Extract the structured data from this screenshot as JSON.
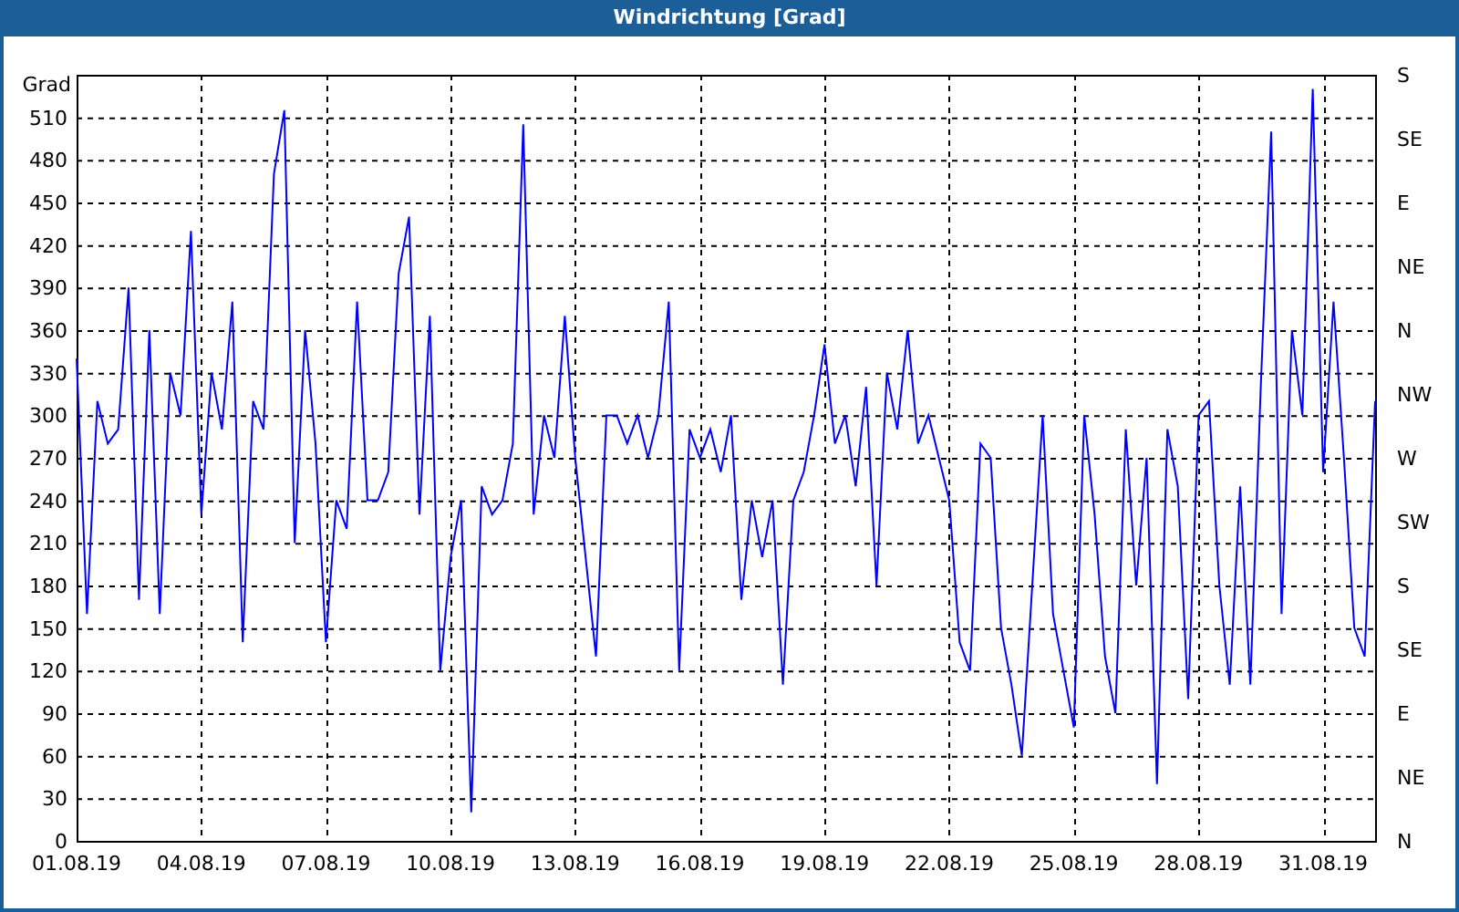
{
  "window": {
    "title": "Windrichtung [Grad]"
  },
  "chart": {
    "chart_data": {
      "type": "line",
      "grid": true,
      "ylabel": "Grad",
      "ylim": [
        0,
        540
      ],
      "yticks": [
        0,
        30,
        60,
        90,
        120,
        150,
        180,
        210,
        240,
        270,
        300,
        330,
        360,
        390,
        420,
        450,
        480,
        510
      ],
      "categories": [
        "01.08.19",
        null,
        null,
        null,
        null,
        null,
        null,
        null,
        null,
        null,
        null,
        null,
        "04.08.19",
        null,
        null,
        null,
        null,
        null,
        null,
        null,
        null,
        null,
        null,
        null,
        "07.08.19",
        null,
        null,
        null,
        null,
        null,
        null,
        null,
        null,
        null,
        null,
        null,
        "10.08.19",
        null,
        null,
        null,
        null,
        null,
        null,
        null,
        null,
        null,
        null,
        null,
        "13.08.19",
        null,
        null,
        null,
        null,
        null,
        null,
        null,
        null,
        null,
        null,
        null,
        "16.08.19",
        null,
        null,
        null,
        null,
        null,
        null,
        null,
        null,
        null,
        null,
        null,
        "19.08.19",
        null,
        null,
        null,
        null,
        null,
        null,
        null,
        null,
        null,
        null,
        null,
        "22.08.19",
        null,
        null,
        null,
        null,
        null,
        null,
        null,
        null,
        null,
        null,
        null,
        "25.08.19",
        null,
        null,
        null,
        null,
        null,
        null,
        null,
        null,
        null,
        null,
        null,
        "28.08.19",
        null,
        null,
        null,
        null,
        null,
        null,
        null,
        null,
        null,
        null,
        null,
        "31.08.19",
        null,
        null,
        null,
        null,
        null
      ],
      "series": [
        {
          "color": "#0000ff",
          "values": [
            340,
            160,
            310,
            280,
            290,
            390,
            170,
            360,
            160,
            330,
            300,
            430,
            230,
            330,
            290,
            380,
            140,
            310,
            290,
            470,
            515,
            210,
            360,
            280,
            140,
            240,
            220,
            380,
            240,
            240,
            260,
            400,
            440,
            230,
            370,
            120,
            200,
            240,
            20,
            250,
            230,
            240,
            280,
            505,
            230,
            300,
            270,
            370,
            270,
            200,
            130,
            300,
            300,
            280,
            300,
            270,
            300,
            380,
            120,
            290,
            270,
            290,
            260,
            300,
            170,
            240,
            200,
            240,
            110,
            240,
            260,
            300,
            350,
            280,
            300,
            250,
            320,
            180,
            330,
            290,
            360,
            280,
            300,
            270,
            240,
            140,
            120,
            280,
            270,
            150,
            110,
            60,
            180,
            300,
            160,
            120,
            80,
            300,
            230,
            130,
            90,
            290,
            180,
            270,
            40,
            290,
            250,
            100,
            300,
            310,
            180,
            110,
            250,
            110,
            320,
            500,
            160,
            360,
            300,
            530,
            260,
            380,
            270,
            150,
            130,
            310
          ]
        }
      ]
    },
    "right_axis_labels": [
      "S",
      "SE",
      "E",
      "NE",
      "N",
      "NW",
      "W",
      "SW",
      "S",
      "SE",
      "E",
      "NE",
      "N"
    ]
  }
}
